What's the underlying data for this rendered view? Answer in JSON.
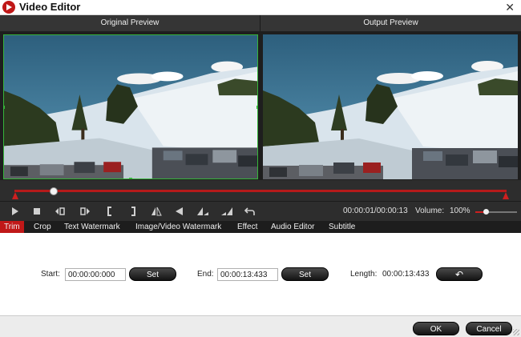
{
  "window": {
    "title": "Video Editor",
    "close_glyph": "✕"
  },
  "preview": {
    "original_label": "Original Preview",
    "output_label": "Output Preview"
  },
  "controls": {
    "play_icon": "play-icon",
    "stop_icon": "stop-icon",
    "time": "00:00:01/00:00:13",
    "volume_label": "Volume:",
    "volume_value": "100%",
    "volume_level": 0.25
  },
  "timeline": {
    "playhead_fraction": 0.08
  },
  "tabs": [
    {
      "label": "Trim",
      "active": true
    },
    {
      "label": "Crop",
      "active": false
    },
    {
      "label": "Text Watermark",
      "active": false
    },
    {
      "label": "Image/Video Watermark",
      "active": false
    },
    {
      "label": "Effect",
      "active": false
    },
    {
      "label": "Audio Editor",
      "active": false
    },
    {
      "label": "Subtitle",
      "active": false
    }
  ],
  "trim": {
    "start_label": "Start:",
    "start_value": "00:00:00:000",
    "end_label": "End:",
    "end_value": "00:00:13:433",
    "length_label": "Length:",
    "length_value": "00:00:13:433",
    "set_label": "Set",
    "reset_glyph": "↶"
  },
  "footer": {
    "ok_label": "OK",
    "cancel_label": "Cancel"
  },
  "colors": {
    "accent": "#c01818",
    "dark_bg": "#2d2d2d",
    "selection_green": "#36b53a"
  }
}
